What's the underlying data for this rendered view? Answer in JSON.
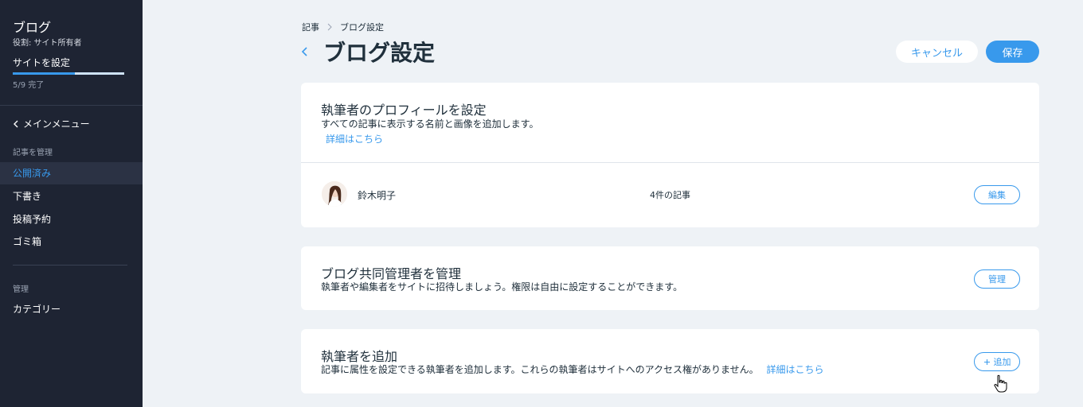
{
  "sidebar": {
    "title": "ブログ",
    "role": "役割: サイト所有者",
    "setup_label": "サイトを設定",
    "progress_fraction": 0.5556,
    "progress_text": "5/9 完了",
    "back_label": "メインメニュー",
    "section_posts": "記事を管理",
    "items": [
      {
        "label": "公開済み"
      },
      {
        "label": "下書き"
      },
      {
        "label": "投稿予約"
      },
      {
        "label": "ゴミ箱"
      }
    ],
    "section_manage": "管理",
    "categories_label": "カテゴリー"
  },
  "breadcrumb": {
    "root": "記事",
    "current": "ブログ設定"
  },
  "header": {
    "title": "ブログ設定",
    "cancel_label": "キャンセル",
    "save_label": "保存"
  },
  "profile_card": {
    "title": "執筆者のプロフィールを設定",
    "description": "すべての記事に表示する名前と画像を追加します。",
    "learn_more": "詳細はこちら",
    "author_name": "鈴木明子",
    "post_count": "4件の記事",
    "edit_label": "編集"
  },
  "coadmin_card": {
    "title": "ブログ共同管理者を管理",
    "description": "執筆者や編集者をサイトに招待しましょう。権限は自由に設定することができます。",
    "manage_label": "管理"
  },
  "writer_card": {
    "title": "執筆者を追加",
    "description": "記事に属性を設定できる執筆者を追加します。これらの執筆者はサイトへのアクセス権がありません。",
    "learn_more": "詳細はこちら",
    "add_label": "追加"
  },
  "colors": {
    "accent": "#3899ec",
    "sidebar_bg": "#1e2433",
    "page_bg": "#eef2f6"
  }
}
